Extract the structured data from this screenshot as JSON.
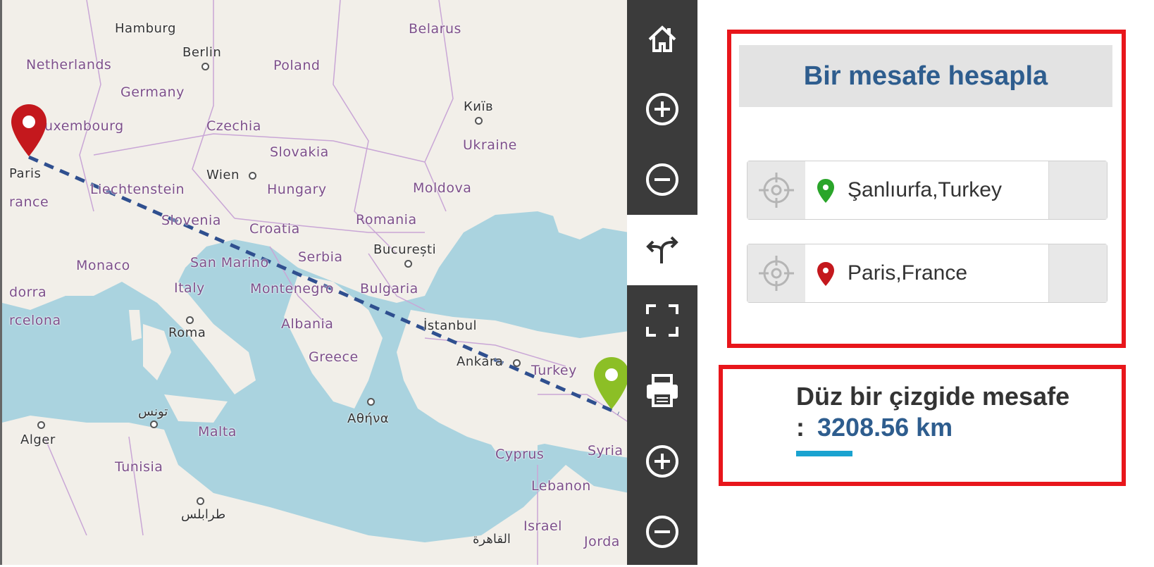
{
  "map": {
    "labels": {
      "hamburg": "Hamburg",
      "belarus": "Belarus",
      "berlin": "Berlin",
      "netherlands": "Netherlands",
      "poland": "Poland",
      "germany": "Germany",
      "kyiv": "Київ",
      "luxembourg": "uxembourg",
      "czechia": "Czechia",
      "ukraine": "Ukraine",
      "slovakia": "Slovakia",
      "paris": "Paris",
      "wien": "Wien",
      "liechtenstein": "Liechtenstein",
      "hungary": "Hungary",
      "moldova": "Moldova",
      "france": "rance",
      "slovenia": "Slovenia",
      "romania": "Romania",
      "croatia": "Croatia",
      "bucuresti": "București",
      "monaco": "Monaco",
      "san_marino": "San Marino",
      "serbia": "Serbia",
      "andorra": "dorra",
      "italy": "Italy",
      "montenegro": "Montenegro",
      "bulgaria": "Bulgaria",
      "barcelona": "rcelona",
      "albania": "Albania",
      "istanbul": "İstanbul",
      "roma": "Roma",
      "greece": "Greece",
      "ankara": "Ankara",
      "turkey": "Turkey",
      "tunis": "تونس",
      "athina": "Αθήνα",
      "alger": "Alger",
      "malta": "Malta",
      "tunisia": "Tunisia",
      "cyprus": "Cyprus",
      "syria": "Syria",
      "lebanon": "Lebanon",
      "tripoli": "طرابلس",
      "israel": "Israel",
      "cairo": "القاهرة",
      "jordan": "Jorda"
    },
    "route_color": "#2f4f8f",
    "origin_pin_color": "#c4181d",
    "destination_pin_color": "#8cbf26",
    "sea_color": "#aad3df",
    "land_color": "#f2efe9"
  },
  "toolbar": {
    "items": [
      "home-icon",
      "zoom-in-icon",
      "zoom-out-icon",
      "route-icon",
      "fullscreen-icon",
      "print-icon",
      "zoom-in-icon",
      "zoom-out-icon"
    ],
    "active": "route-icon"
  },
  "panel": {
    "title": "Bir mesafe hesapla",
    "from": "Şanlıurfa,Turkey",
    "to": "Paris,France",
    "result_label": "Düz bir çizgide mesafe",
    "result_colon": ":",
    "result_value": "3208.56 km",
    "accent_color": "#2e5d8e",
    "frame_color": "#e8161b",
    "underline_color": "#1aa3d0"
  }
}
